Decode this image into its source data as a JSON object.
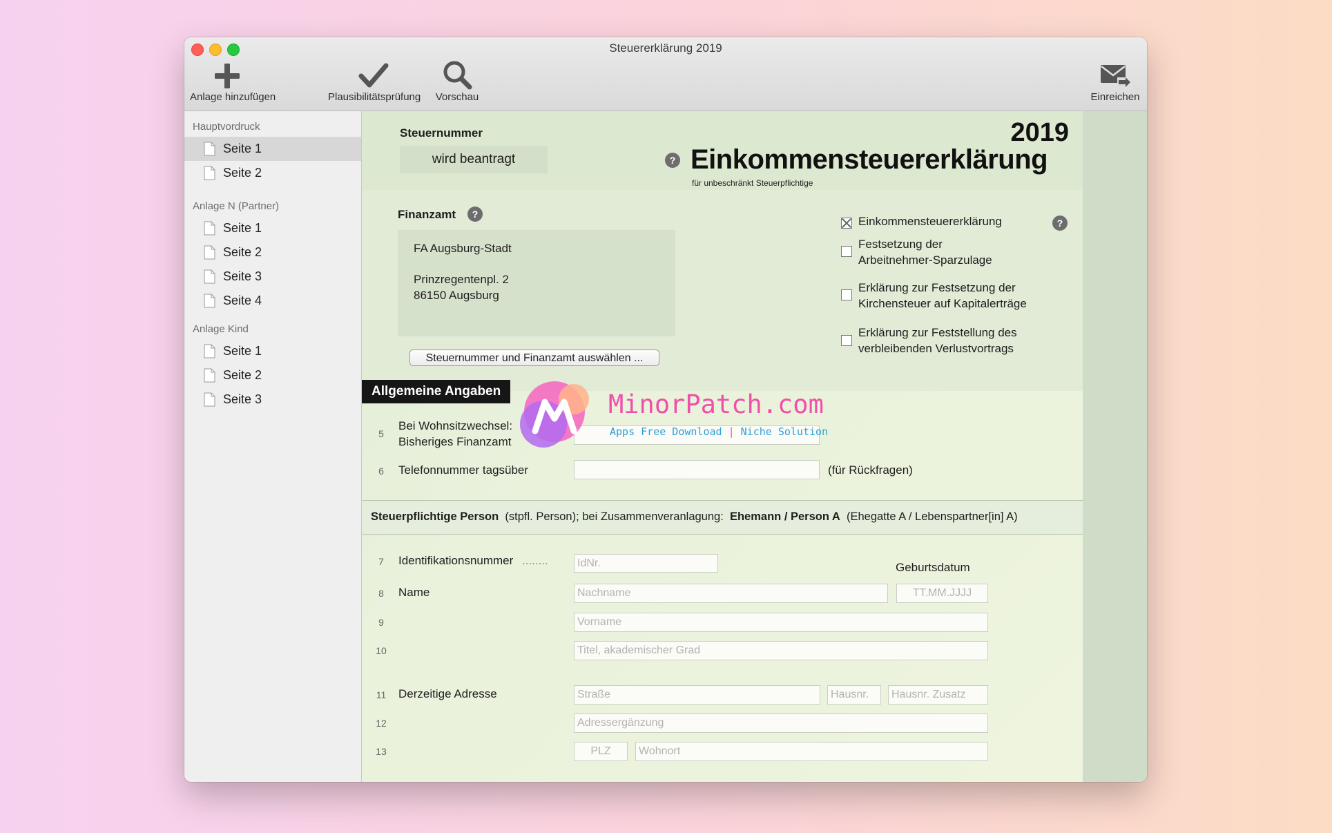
{
  "window": {
    "title": "Steuererklärung 2019"
  },
  "toolbar": {
    "add_attachment": "Anlage hinzufügen",
    "plausibility": "Plausibilitätsprüfung",
    "preview": "Vorschau",
    "submit": "Einreichen"
  },
  "sidebar": {
    "groups": [
      {
        "title": "Hauptvordruck",
        "items": [
          "Seite 1",
          "Seite 2"
        ],
        "selected": 0
      },
      {
        "title": "Anlage N (Partner)",
        "items": [
          "Seite 1",
          "Seite 2",
          "Seite 3",
          "Seite 4"
        ]
      },
      {
        "title": "Anlage Kind",
        "items": [
          "Seite 1",
          "Seite 2",
          "Seite 3"
        ]
      }
    ]
  },
  "header": {
    "steuernummer_label": "Steuernummer",
    "steuernummer_value": "wird beantragt",
    "year": "2019",
    "form_title": "Einkommensteuererklärung",
    "form_subtitle": "für unbeschränkt Steuerpflichtige",
    "help": "?"
  },
  "finanzamt": {
    "label": "Finanzamt",
    "name": "FA Augsburg-Stadt",
    "street": "Prinzregentenpl. 2",
    "city": "86150 Augsburg",
    "select_button": "Steuernummer und Finanzamt auswählen ..."
  },
  "declarations": [
    {
      "lines": [
        "Einkommensteuererklärung"
      ],
      "checked": true
    },
    {
      "lines": [
        "Festsetzung der",
        "Arbeitnehmer-Sparzulage"
      ],
      "checked": false
    },
    {
      "lines": [
        "Erklärung zur Festsetzung der",
        "Kirchensteuer auf Kapitalerträge"
      ],
      "checked": false
    },
    {
      "lines": [
        "Erklärung zur Feststellung des",
        "verbleibenden Verlustvortrags"
      ],
      "checked": false
    }
  ],
  "allgemein": {
    "title": "Allgemeine Angaben",
    "row5_num": "5",
    "row5_line1": "Bei Wohnsitzwechsel:",
    "row5_line2": "Bisheriges Finanzamt",
    "row6_num": "6",
    "row6_label": "Telefonnummer tagsüber",
    "row6_note": "(für Rückfragen)"
  },
  "person": {
    "header_bold1": "Steuerpflichtige Person",
    "header_text1": "(stpfl. Person); bei Zusammenveranlagung:",
    "header_bold2": "Ehemann / Person A",
    "header_text2": "(Ehegatte A / Lebenspartner[in] A)",
    "row7_num": "7",
    "row7_label": "Identifikationsnummer",
    "row7_dots": "........",
    "idnr_placeholder": "IdNr.",
    "geburtsdatum_label": "Geburtsdatum",
    "row8_num": "8",
    "row8_label": "Name",
    "nachname_placeholder": "Nachname",
    "date_placeholder": "TT.MM.JJJJ",
    "row9_num": "9",
    "vorname_placeholder": "Vorname",
    "row10_num": "10",
    "titel_placeholder": "Titel, akademischer Grad",
    "row11_num": "11",
    "row11_label": "Derzeitige Adresse",
    "strasse_placeholder": "Straße",
    "hausnr_placeholder": "Hausnr.",
    "hausnr_zusatz_placeholder": "Hausnr. Zusatz",
    "row12_num": "12",
    "adressergaenzung_placeholder": "Adressergänzung",
    "row13_num": "13",
    "plz_placeholder": "PLZ",
    "wohnort_placeholder": "Wohnort"
  },
  "watermark": {
    "brand": "MinorPatch.com",
    "tagline_left": "Apps Free Download",
    "tagline_sep": "|",
    "tagline_right": "Niche Solution"
  }
}
